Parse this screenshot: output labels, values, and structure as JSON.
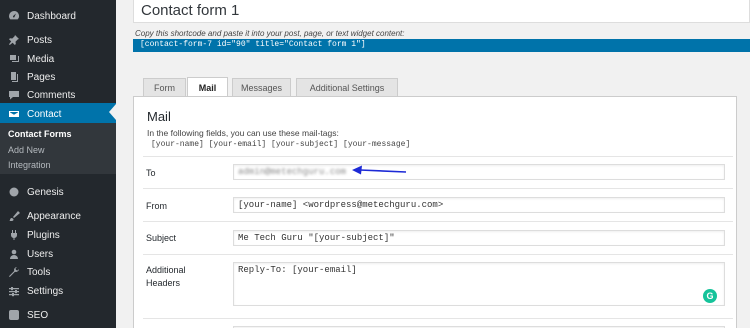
{
  "sidebar": {
    "items": [
      {
        "label": "Dashboard",
        "icon": "dashboard-icon"
      },
      {
        "label": "Posts",
        "icon": "pin-icon"
      },
      {
        "label": "Media",
        "icon": "media-icon"
      },
      {
        "label": "Pages",
        "icon": "pages-icon"
      },
      {
        "label": "Comments",
        "icon": "comment-icon"
      },
      {
        "label": "Contact",
        "icon": "mail-icon"
      },
      {
        "label": "Genesis",
        "icon": "genesis-icon"
      },
      {
        "label": "Appearance",
        "icon": "brush-icon"
      },
      {
        "label": "Plugins",
        "icon": "plug-icon"
      },
      {
        "label": "Users",
        "icon": "users-icon"
      },
      {
        "label": "Tools",
        "icon": "wrench-icon"
      },
      {
        "label": "Settings",
        "icon": "sliders-icon"
      },
      {
        "label": "SEO",
        "icon": "seo-icon"
      }
    ],
    "submenu": [
      "Contact Forms",
      "Add New",
      "Integration"
    ],
    "accent": "#0073aa"
  },
  "main": {
    "title": "Contact form 1",
    "shortcode_hint": "Copy this shortcode and paste it into your post, page, or text widget content:",
    "shortcode": "[contact-form-7 id=\"90\" title=\"Contact form 1\"]",
    "tabs": [
      "Form",
      "Mail",
      "Messages",
      "Additional Settings"
    ],
    "active_tab": "Mail"
  },
  "mail": {
    "title": "Mail",
    "description": "In the following fields, you can use these mail-tags:",
    "tags": "[your-name] [your-email] [your-subject] [your-message]",
    "fields": {
      "to": {
        "label": "To",
        "value": "admin@metechguru.com"
      },
      "from": {
        "label": "From",
        "value": "[your-name] <wordpress@metechguru.com>"
      },
      "subject": {
        "label": "Subject",
        "value": "Me Tech Guru \"[your-subject]\""
      },
      "headers": {
        "label_line1": "Additional",
        "label_line2": "Headers",
        "value": "Reply-To: [your-email]"
      }
    }
  },
  "grammarly_letter": "G"
}
